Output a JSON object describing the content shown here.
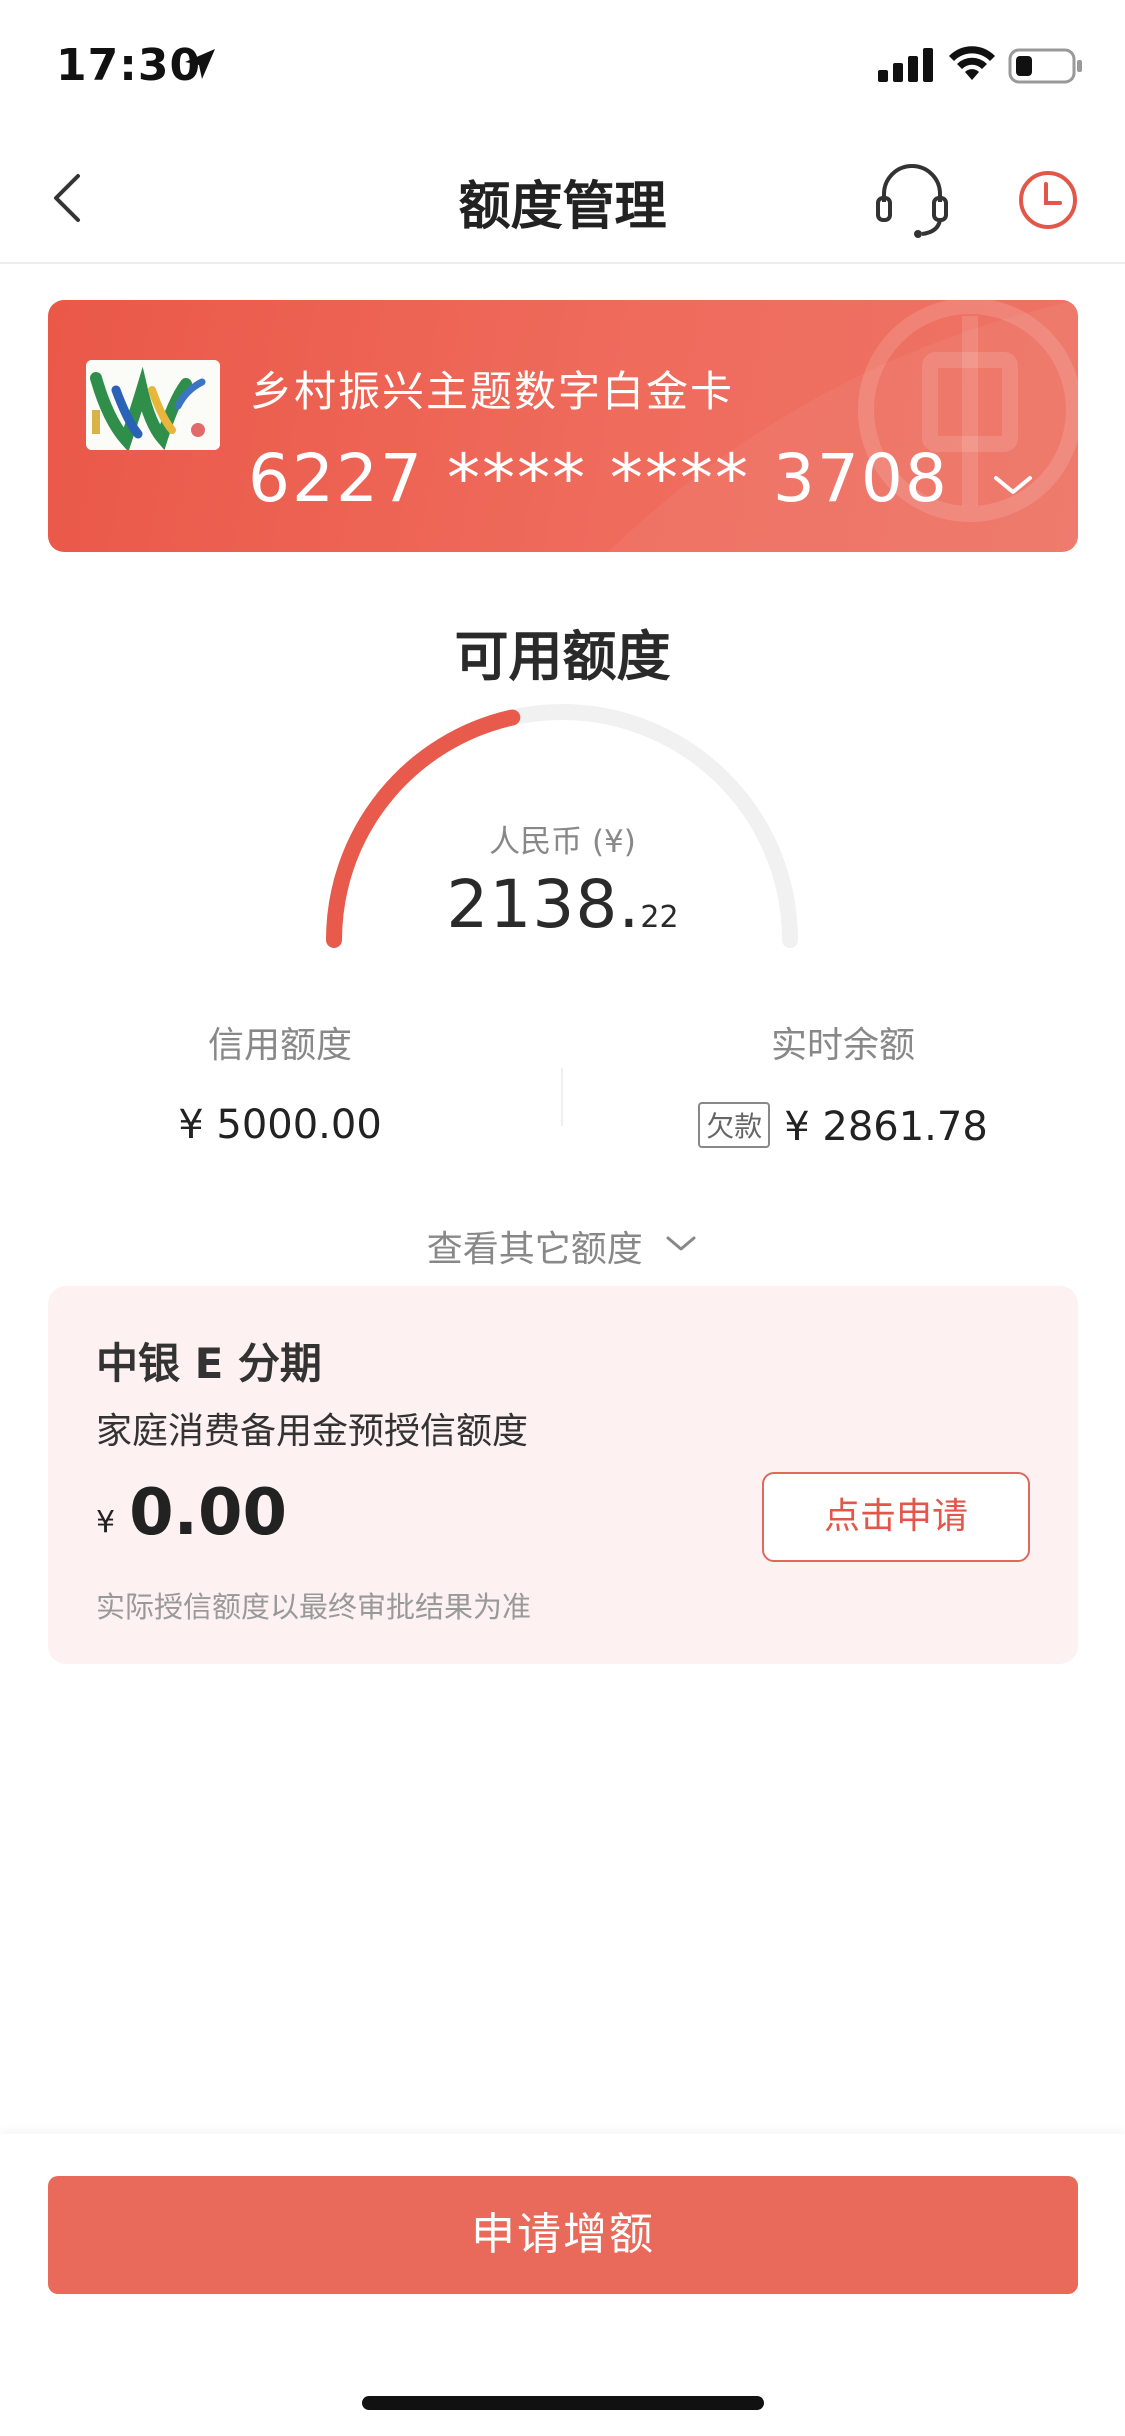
{
  "status_bar": {
    "time": "17:30"
  },
  "nav": {
    "title": "额度管理"
  },
  "card": {
    "name": "乡村振兴主题数字白金卡",
    "number": "6227 **** **** 3708"
  },
  "available": {
    "title": "可用额度",
    "currency_label": "人民币 (¥)",
    "amount_int": "2138.",
    "amount_dec": "22",
    "gauge_fraction": 0.43
  },
  "stats": {
    "credit_limit_label": "信用额度",
    "credit_limit_value": "¥ 5000.00",
    "balance_label": "实时余额",
    "debt_badge": "欠款",
    "balance_value": "¥ 2861.78"
  },
  "other_quota": {
    "label": "查看其它额度"
  },
  "installment": {
    "title": "中银 E 分期",
    "subtitle": "家庭消费备用金预授信额度",
    "currency": "¥",
    "amount": "0.00",
    "apply_label": "点击申请",
    "note": "实际授信额度以最终审批结果为准"
  },
  "bottom": {
    "increase_label": "申请增额"
  },
  "colors": {
    "accent": "#e96a5b",
    "card": "#ea5848",
    "installment_bg": "#fdf2f1"
  }
}
